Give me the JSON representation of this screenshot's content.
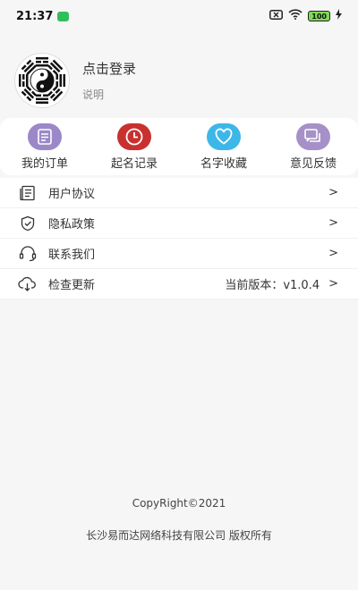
{
  "status_bar": {
    "time": "21:37",
    "battery": "100",
    "icons": [
      "notification-icon",
      "sim-off-icon",
      "wifi-icon",
      "battery-icon",
      "charging-icon"
    ]
  },
  "profile": {
    "login": "点击登录",
    "subtitle": "说明",
    "avatar_icon": "bagua-yinyang-icon"
  },
  "quick_actions": [
    {
      "label": "我的订单",
      "icon": "order-icon",
      "color": "#9b88c9"
    },
    {
      "label": "起名记录",
      "icon": "clock-icon",
      "color": "#c8312f"
    },
    {
      "label": "名字收藏",
      "icon": "heart-icon",
      "color": "#3db7e8"
    },
    {
      "label": "意见反馈",
      "icon": "feedback-icon",
      "color": "#a591c7"
    }
  ],
  "menu": [
    {
      "label": "用户协议",
      "icon": "document-icon",
      "value": ""
    },
    {
      "label": "隐私政策",
      "icon": "shield-icon",
      "value": ""
    },
    {
      "label": "联系我们",
      "icon": "headset-icon",
      "value": ""
    },
    {
      "label": "检查更新",
      "icon": "cloud-download-icon",
      "value": "当前版本：v1.0.4"
    }
  ],
  "footer": {
    "copyright": "CopyRight©2021",
    "company": "长沙易而达网络科技有限公司 版权所有"
  }
}
